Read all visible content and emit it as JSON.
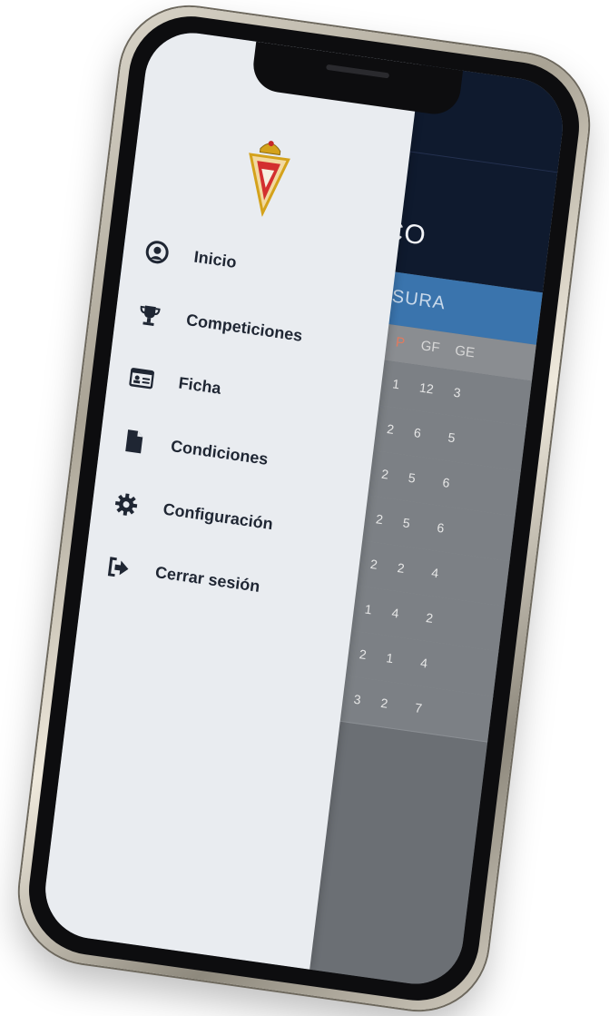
{
  "drawer": {
    "logo": "real-murcia-crest-icon",
    "items": [
      {
        "label": "Inicio",
        "icon": "user-circle-icon"
      },
      {
        "label": "Competiciones",
        "icon": "trophy-icon"
      },
      {
        "label": "Ficha",
        "icon": "id-card-icon"
      },
      {
        "label": "Condiciones",
        "icon": "document-icon"
      },
      {
        "label": "Configuración",
        "icon": "gear-icon"
      },
      {
        "label": "Cerrar sesión",
        "icon": "sign-out-icon"
      }
    ]
  },
  "background_app": {
    "title_fragment": "CO",
    "tab_fragment": "AUSURA",
    "table": {
      "headers": [
        "P",
        "GF",
        "GE"
      ],
      "rows": [
        [
          "1",
          "12",
          "3"
        ],
        [
          "2",
          "6",
          "5"
        ],
        [
          "2",
          "5",
          "6"
        ],
        [
          "2",
          "5",
          "6"
        ],
        [
          "2",
          "2",
          "4"
        ],
        [
          "1",
          "4",
          "2"
        ],
        [
          "2",
          "1",
          "4"
        ],
        [
          "3",
          "2",
          "7"
        ]
      ]
    }
  },
  "colors": {
    "header_bg": "#0f1a2e",
    "tab_bg": "#3a74ad",
    "drawer_bg": "#e9ecf0",
    "menu_text": "#1f2633",
    "points_header": "#e07a5f"
  }
}
